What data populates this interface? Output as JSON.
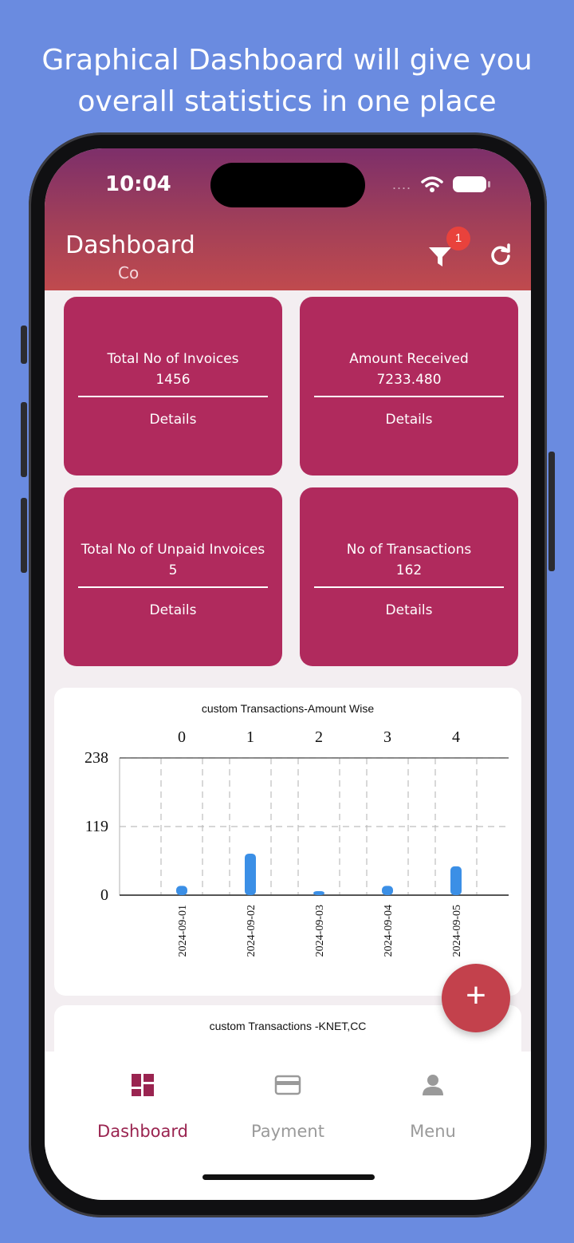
{
  "promo": {
    "line1": "Graphical Dashboard will give you",
    "line2": "overall statistics in one place"
  },
  "status_bar": {
    "time": "10:04",
    "signal": "...."
  },
  "header": {
    "title": "Dashboard",
    "subtitle": "Co",
    "filter_badge": "1"
  },
  "cards": [
    {
      "label": "Total No of Invoices",
      "value": "1456",
      "details": "Details"
    },
    {
      "label": "Amount Received",
      "value": "7233.480",
      "details": "Details"
    },
    {
      "label": "Total No of Unpaid Invoices",
      "value": "5",
      "details": "Details"
    },
    {
      "label": "No of Transactions",
      "value": "162",
      "details": "Details"
    }
  ],
  "chart_data": [
    {
      "type": "bar",
      "title": "custom Transactions-Amount Wise",
      "top_ticks": [
        "0",
        "1",
        "2",
        "3",
        "4"
      ],
      "categories": [
        "2024-09-01",
        "2024-09-02",
        "2024-09-03",
        "2024-09-04",
        "2024-09-05"
      ],
      "values": [
        16,
        72,
        7,
        16,
        50
      ],
      "y_ticks": [
        "238",
        "119",
        "0"
      ],
      "ylim": [
        0,
        238
      ],
      "grid": true,
      "bar_color": "#3b8fe6"
    },
    {
      "type": "bar",
      "title": "custom Transactions -KNET,CC"
    }
  ],
  "fab": {
    "icon": "plus-icon",
    "label": "+"
  },
  "tabs": [
    {
      "label": "Dashboard",
      "icon": "dashboard-icon",
      "active": true
    },
    {
      "label": "Payment",
      "icon": "card-icon",
      "active": false
    },
    {
      "label": "Menu",
      "icon": "user-icon",
      "active": false
    }
  ],
  "colors": {
    "background": "#6a8be0",
    "card": "#b02a5d",
    "accent": "#9a2450",
    "fab": "#c3414c",
    "inactive_tab": "#9a9a9a"
  }
}
